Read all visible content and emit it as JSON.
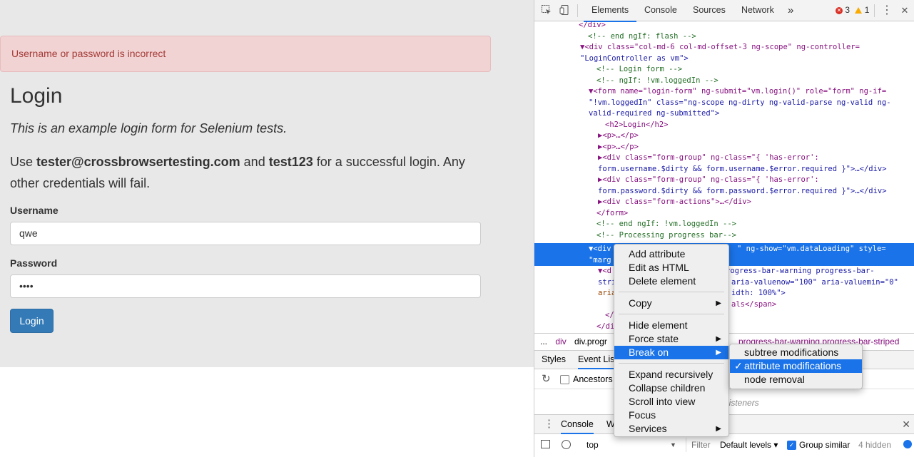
{
  "page": {
    "alert": "Username or password is incorrect",
    "title": "Login",
    "subtitle": "This is an example login form for Selenium tests.",
    "instructions_pre": "Use ",
    "instructions_user": "tester@crossbrowsertesting.com",
    "instructions_mid": " and ",
    "instructions_pass": "test123",
    "instructions_post": " for a successful login. Any other credentials will fail.",
    "username_label": "Username",
    "username_value": "qwe",
    "password_label": "Password",
    "password_value": "••••",
    "login_button": "Login"
  },
  "devtools": {
    "tabs": [
      "Elements",
      "Console",
      "Sources",
      "Network"
    ],
    "more_tabs": "»",
    "errors": "3",
    "warnings": "1",
    "menu_dots": "⋮",
    "close": "✕",
    "dom_lines": [
      {
        "t": "</div>"
      },
      {
        "t": "<!-- end ngIf: flash -->"
      },
      {
        "t": "▼<div class=\"col-md-6 col-md-offset-3 ng-scope\" ng-controller="
      },
      {
        "t": "\"LoginController as vm\">"
      },
      {
        "t": "<!-- Login form -->"
      },
      {
        "t": "<!-- ngIf: !vm.loggedIn -->"
      },
      {
        "t": "▼<form name=\"login-form\" ng-submit=\"vm.login()\" role=\"form\" ng-if="
      },
      {
        "t": "\"!vm.loggedIn\" class=\"ng-scope ng-dirty ng-valid-parse ng-valid ng-"
      },
      {
        "t": "valid-required ng-submitted\">"
      },
      {
        "t": "<h2>Login</h2>"
      },
      {
        "t": "▶<p>…</p>"
      },
      {
        "t": "▶<p>…</p>"
      },
      {
        "t": "▶<div class=\"form-group\" ng-class=\"{ 'has-error':"
      },
      {
        "t": "form.username.$dirty && form.username.$error.required }\">…</div>"
      },
      {
        "t": "▶<div class=\"form-group\" ng-class=\"{ 'has-error':"
      },
      {
        "t": "form.password.$dirty && form.password.$error.required }\">…</div>"
      },
      {
        "t": "▶<div class=\"form-actions\">…</div>"
      },
      {
        "t": "</form>"
      },
      {
        "t": "<!-- end ngIf: !vm.loggedIn -->"
      },
      {
        "t": "<!-- Processing progress bar-->"
      },
      {
        "t": "▼<div"
      },
      {
        "t": "\"marg"
      },
      {
        "t": "▼<d"
      },
      {
        "t": "stri"
      },
      {
        "t": "aria"
      },
      {
        "t": "</"
      },
      {
        "t": "</di"
      }
    ],
    "sel_right_1": "\" ng-show=\"vm.dataLoading\" style=",
    "dom_right_1": "rogress-bar-warning progress-bar-",
    "dom_right_2": "aria-valuenow=\"100\" aria-valuemin=\"0\"",
    "dom_right_3": "idth: 100%\">",
    "dom_right_4": "als</span>",
    "crumbs": [
      "...",
      "div",
      "div.progr"
    ],
    "crumb_right": "progress-bar-warning.progress-bar-striped",
    "subtabs": [
      "Styles",
      "Event Lis"
    ],
    "ancestors": "Ancestors",
    "listeners_note": "listeners",
    "drawer_tabs": [
      "Console",
      "W"
    ],
    "console_context": "top",
    "filter": "Filter",
    "levels": "Default levels ▾",
    "group_similar": "Group similar",
    "hidden": "4 hidden"
  },
  "context_menu": {
    "items": [
      "Add attribute",
      "Edit as HTML",
      "Delete element",
      "Copy",
      "Hide element",
      "Force state",
      "Break on",
      "Expand recursively",
      "Collapse children",
      "Scroll into view",
      "Focus",
      "Services"
    ],
    "submenu": [
      "subtree modifications",
      "attribute modifications",
      "node removal"
    ],
    "check": "✓",
    "arrow": "▶"
  }
}
